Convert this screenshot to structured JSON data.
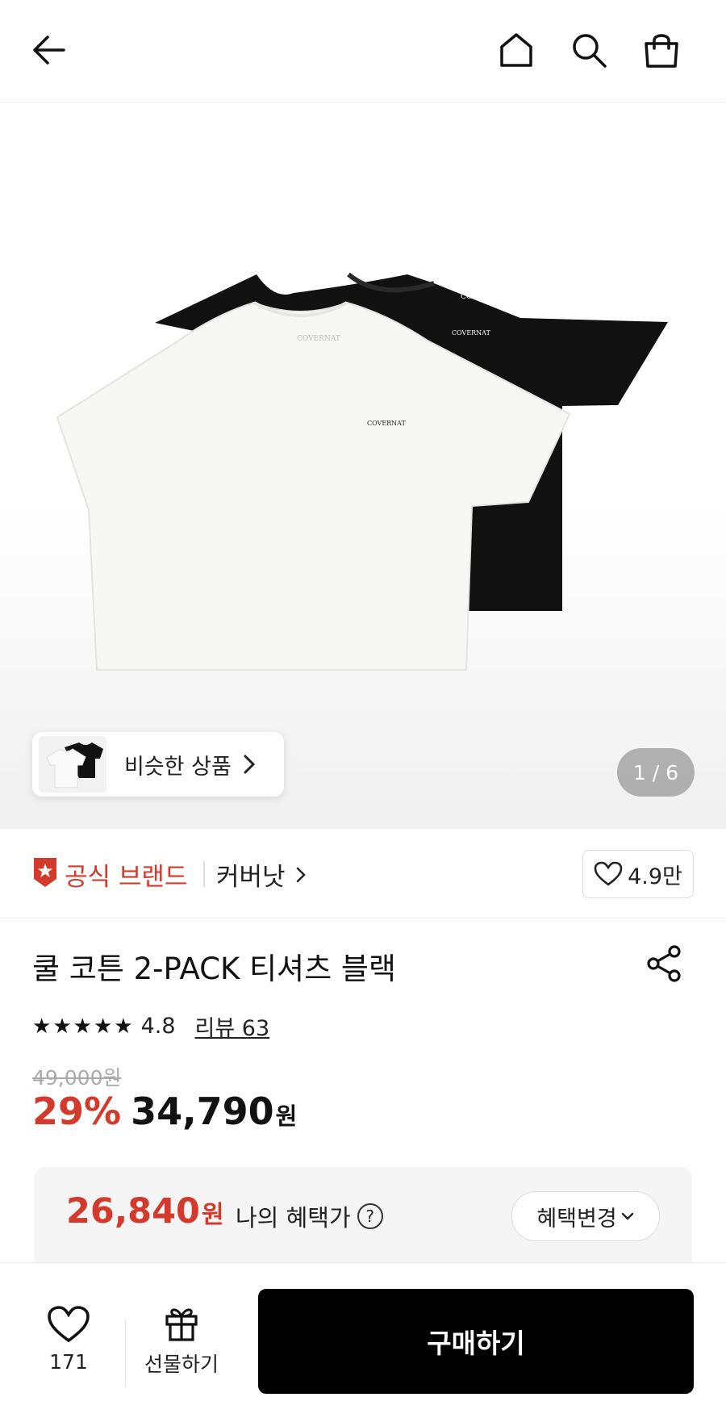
{
  "header": {
    "back_icon": "back-arrow-icon",
    "home_icon": "home-icon",
    "search_icon": "search-icon",
    "cart_icon": "shopping-bag-icon"
  },
  "gallery": {
    "similar_label": "비슷한 상품",
    "pager": "1 / 6",
    "shirt_logo": "COVERNAT"
  },
  "brand": {
    "official_label": "공식 브랜드",
    "name": "커버낫",
    "likes": "4.9만"
  },
  "product": {
    "title": "쿨 코튼 2-PACK 티셔츠 블랙",
    "rating": "4.8",
    "stars": 5,
    "reviews_label": "리뷰 63",
    "original_price": "49,000원",
    "discount": "29%",
    "price": "34,790",
    "currency": "원"
  },
  "benefit": {
    "price": "26,840",
    "currency": "원",
    "label": "나의 혜택가",
    "help": "?",
    "change_label": "혜택변경"
  },
  "bottom": {
    "wish_count": "171",
    "gift_label": "선물하기",
    "buy_label": "구매하기"
  },
  "colors": {
    "accent_red": "#d33a2c",
    "buy_button": "#000000"
  }
}
